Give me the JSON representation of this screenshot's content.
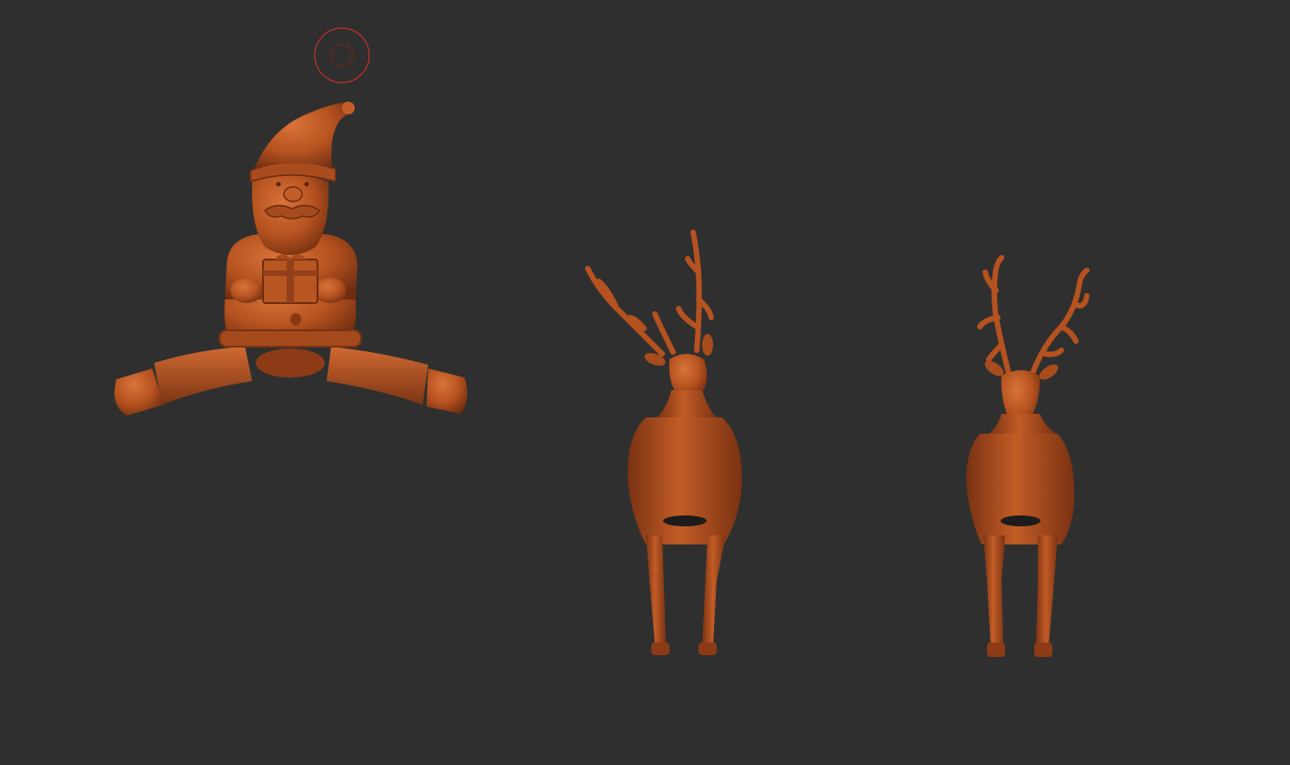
{
  "viewport": {
    "background": "#2f2f2f",
    "material_color": "#b5521f",
    "material_shadow": "#7a3212",
    "material_highlight": "#d8723a",
    "brush_cursor_color": "#c0302a"
  },
  "scene": {
    "models": [
      {
        "name": "santa-gnome"
      },
      {
        "name": "reindeer-a"
      },
      {
        "name": "reindeer-b"
      }
    ],
    "brush_cursor": {
      "visible": true
    }
  }
}
